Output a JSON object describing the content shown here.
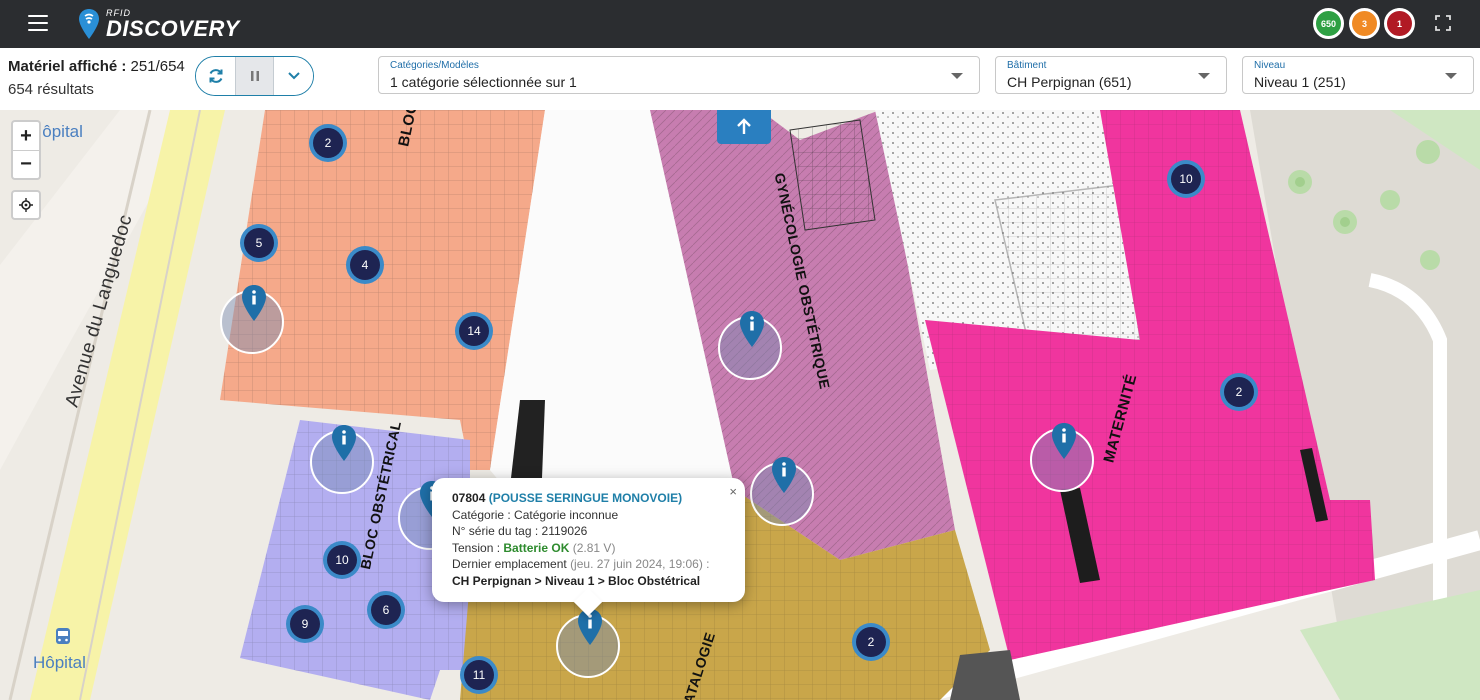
{
  "app": {
    "logo_small": "RFID",
    "logo_big": "DISCOVERY",
    "badges": {
      "green": "650",
      "orange": "3",
      "red": "1"
    }
  },
  "filters": {
    "count_label": "Matériel affiché :",
    "count_value": "251/654",
    "results": "654 résultats",
    "categories": {
      "label": "Catégories/Modèles",
      "value": "1 catégorie sélectionnée sur 1"
    },
    "batiment": {
      "label": "Bâtiment",
      "value": "CH Perpignan (651)"
    },
    "niveau": {
      "label": "Niveau",
      "value": "Niveau 1 (251)"
    }
  },
  "map": {
    "zoom_in": "+",
    "zoom_out": "−",
    "street": "Avenue du Languedoc",
    "place_top": "Hôpital",
    "place_bottom": "Hôpital",
    "areas": {
      "bloc_top": "BLOC",
      "bloc_obstetrical": "BLOC OBSTÉTRICAL",
      "gynecologie": "GYNÉCOLOGIE OBSTÉTRIQUE",
      "maternite": "MATERNITÉ",
      "natalogie": "NATALOGIE"
    },
    "clusters": [
      "2",
      "5",
      "4",
      "14",
      "10",
      "6",
      "9",
      "11",
      "2",
      "10",
      "2"
    ]
  },
  "popup": {
    "id": "07804",
    "name": "(POUSSE SERINGUE MONOVOIE)",
    "category_label": "Catégorie :",
    "category_value": "Catégorie inconnue",
    "serial_label": "N° série du tag :",
    "serial_value": "2119026",
    "tension_label": "Tension :",
    "tension_status": "Batterie OK",
    "tension_value": "(2.81 V)",
    "location_label": "Dernier emplacement",
    "location_date": "(jeu. 27 juin 2024, 19:06) :",
    "location_path": "CH Perpignan > Niveau 1 > Bloc Obstétrical",
    "close": "×"
  },
  "colors": {
    "topbar": "#2b2d30",
    "accent": "#1f7fa8",
    "cluster_inner": "#1e2452",
    "cluster_ring": "#3b8ac8",
    "zone_orange": "#f5a98a",
    "zone_purple": "#b3aef0",
    "zone_mauve": "#c77db0",
    "zone_pink": "#f0359e",
    "zone_yellow": "#c9a64a"
  }
}
